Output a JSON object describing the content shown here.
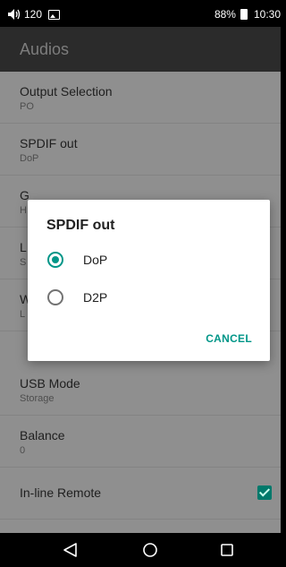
{
  "status_bar": {
    "volume_text": "120",
    "speaker_icon": "speaker-icon",
    "notification_icon": "image-icon",
    "battery_text": "88%",
    "time": "10:30"
  },
  "app_bar": {
    "title": "Audios"
  },
  "settings": [
    {
      "label": "Output Selection",
      "summary": "PO"
    },
    {
      "label": "SPDIF out",
      "summary": "DoP"
    },
    {
      "label": "G",
      "summary": "H"
    },
    {
      "label": "L",
      "summary": "S"
    },
    {
      "label": "W",
      "summary": "L"
    },
    {
      "label": "USB Mode",
      "summary": "Storage"
    },
    {
      "label": "Balance",
      "summary": "0"
    },
    {
      "label": "In-line Remote",
      "checked": true
    },
    {
      "label": "",
      "checked": false
    }
  ],
  "dialog": {
    "title": "SPDIF out",
    "options": [
      {
        "label": "DoP",
        "selected": true
      },
      {
        "label": "D2P",
        "selected": false
      }
    ],
    "cancel_label": "CANCEL"
  },
  "nav_bar": {
    "back_icon": "back-icon",
    "home_icon": "home-icon",
    "recents_icon": "recents-icon"
  },
  "colors": {
    "accent": "#009688",
    "checkbox_checked": "#00796b",
    "list_background": "#8f8f8f",
    "app_bar_background": "#2b2b2b"
  }
}
